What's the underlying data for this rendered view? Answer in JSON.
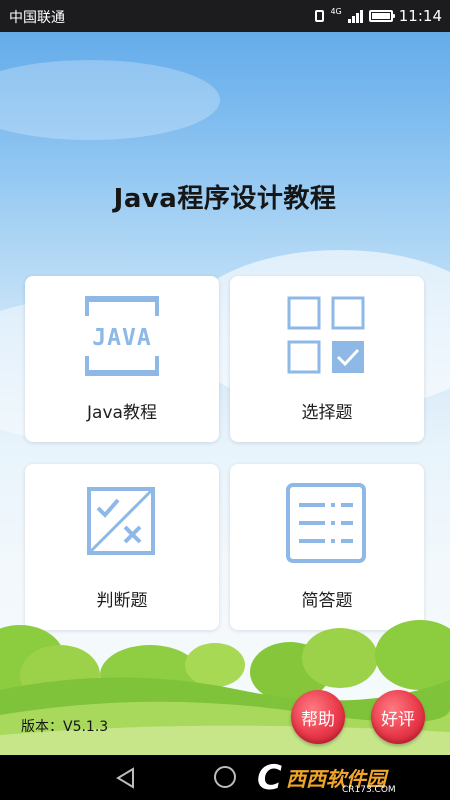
{
  "status_bar": {
    "carrier": "中国联通",
    "network": "4G",
    "time": "11:14"
  },
  "app": {
    "title": "Java程序设计教程"
  },
  "menu": [
    {
      "label": "Java教程",
      "icon": "java-book-icon",
      "icon_text": "JAVA"
    },
    {
      "label": "选择题",
      "icon": "multiple-choice-grid-icon"
    },
    {
      "label": "判断题",
      "icon": "true-false-icon"
    },
    {
      "label": "简答题",
      "icon": "short-answer-list-icon"
    }
  ],
  "footer": {
    "version": "版本：V5.1.3",
    "help_label": "帮助",
    "rate_label": "好评"
  },
  "watermark": {
    "logo_text": "西西软件园",
    "url": "CR173.COM"
  },
  "colors": {
    "icon_blue": "#8eb8e6",
    "button_red": "#e8394a",
    "status_bar": "#1c1c1e"
  }
}
